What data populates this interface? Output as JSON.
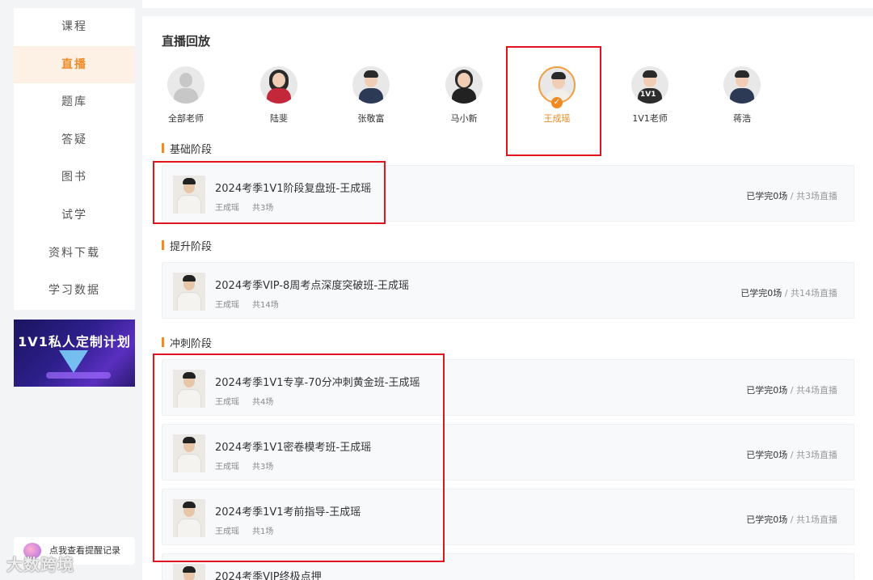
{
  "sidebar": {
    "items": [
      {
        "label": "课程"
      },
      {
        "label": "直播",
        "active": true
      },
      {
        "label": "题库"
      },
      {
        "label": "答疑"
      },
      {
        "label": "图书"
      },
      {
        "label": "试学"
      },
      {
        "label": "资料下载"
      },
      {
        "label": "学习数据"
      }
    ],
    "banner_text": "1V1私人定制计划",
    "remind_label": "点我查看提醒记录",
    "watermark": "大数跨境"
  },
  "main": {
    "title": "直播回放",
    "teachers": [
      {
        "name": "全部老师"
      },
      {
        "name": "陆斐"
      },
      {
        "name": "张敬富"
      },
      {
        "name": "马小新"
      },
      {
        "name": "王成瑶",
        "active": true
      },
      {
        "name": "1V1老师",
        "badge": "1V1"
      },
      {
        "name": "蒋浩"
      }
    ],
    "sections": [
      {
        "title": "基础阶段",
        "courses": [
          {
            "title": "2024考季1V1阶段复盘班-王成瑶",
            "teacher": "王成瑶",
            "count": "共3场",
            "done": "已学完0场",
            "total": "/ 共3场直播"
          }
        ]
      },
      {
        "title": "提升阶段",
        "courses": [
          {
            "title": "2024考季VIP-8周考点深度突破班-王成瑶",
            "teacher": "王成瑶",
            "count": "共14场",
            "done": "已学完0场",
            "total": "/ 共14场直播"
          }
        ]
      },
      {
        "title": "冲刺阶段",
        "courses": [
          {
            "title": "2024考季1V1专享-70分冲刺黄金班-王成瑶",
            "teacher": "王成瑶",
            "count": "共4场",
            "done": "已学完0场",
            "total": "/ 共4场直播"
          },
          {
            "title": "2024考季1V1密卷模考班-王成瑶",
            "teacher": "王成瑶",
            "count": "共3场",
            "done": "已学完0场",
            "total": "/ 共3场直播"
          },
          {
            "title": "2024考季1V1考前指导-王成瑶",
            "teacher": "王成瑶",
            "count": "共1场",
            "done": "已学完0场",
            "total": "/ 共1场直播"
          },
          {
            "title": "2024考季VIP终极点押"
          }
        ]
      }
    ]
  },
  "colors": {
    "accent": "#f08a24",
    "highlight": "#e0141e"
  }
}
